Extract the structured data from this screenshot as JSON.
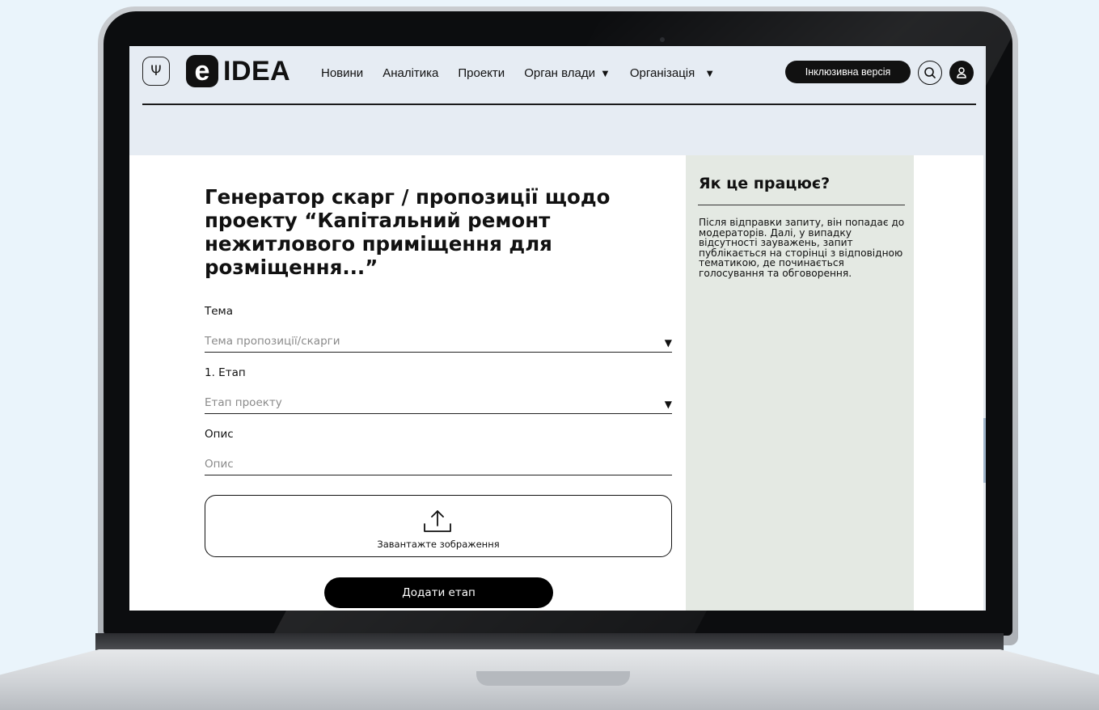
{
  "header": {
    "logo_letter": "e",
    "logo_text": "IDEA",
    "crest_glyph": "Ψ",
    "nav": [
      {
        "label": "Новини",
        "has_caret": false
      },
      {
        "label": "Аналітика",
        "has_caret": false
      },
      {
        "label": "Проекти",
        "has_caret": false
      },
      {
        "label": "Орган влади",
        "has_caret": true
      },
      {
        "label": "Організація",
        "has_caret": true
      }
    ],
    "caret_glyph": "▼",
    "inclusive_button": "Інклюзивна версія",
    "icons": [
      "ukraine-crest-icon",
      "search-icon",
      "user-icon"
    ]
  },
  "form": {
    "title": "Генератор скарг / пропозиції щодо проекту “Капітальний ремонт нежитлового приміщення для розміщення...”",
    "topic_label": "Тема",
    "topic_placeholder": "Тема пропозиції/скарги",
    "stage_label": "1. Етап",
    "stage_placeholder": "Етап проекту",
    "description_label": "Опис",
    "description_placeholder": "Опис",
    "dropdown_arrow": "▼",
    "upload_label": "Завантажте зображення",
    "add_stage_button": "Додати етап"
  },
  "sidebar": {
    "title": "Як це працює?",
    "text": "Після відправки запиту, він попадає до модераторів. Далі, у випадку відсутності зауважень, запит публікається на сторінці з відповідною тематикою, де починається голосування та обговорення."
  },
  "colors": {
    "header_bg": "#e6ecf3",
    "sidebar_bg": "#e4e9e3",
    "accent": "#000000",
    "page_bg": "#eaf4fb"
  }
}
